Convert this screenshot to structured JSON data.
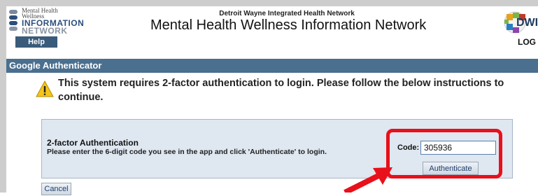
{
  "header": {
    "logo": {
      "line1": "Mental Health",
      "line2": "Wellness",
      "line3": "INFORMATION",
      "line4": "NETWORK"
    },
    "org_name": "Detroit Wayne Integrated Health Network",
    "site_title": "Mental Health Wellness Information Network",
    "partner_logo_text": "DWIH"
  },
  "nav": {
    "help_label": "Help",
    "logout_label": "LOG"
  },
  "section": {
    "title": "Google Authenticator"
  },
  "warning": {
    "text": "This system requires 2-factor authentication to login. Please follow the below instructions to continue."
  },
  "auth": {
    "heading": "2-factor Authentication",
    "description": "Please enter the 6-digit code you see in the app and click 'Authenticate' to login.",
    "code_label": "Code:",
    "code_value": "305936",
    "button_label": "Authenticate"
  },
  "footer": {
    "cancel_label": "Cancel"
  },
  "colors": {
    "section_bar": "#4a6f8f",
    "help_tab": "#3a5b7a",
    "panel_bg": "#dfe7f1",
    "annotation_red": "#e8101a"
  }
}
